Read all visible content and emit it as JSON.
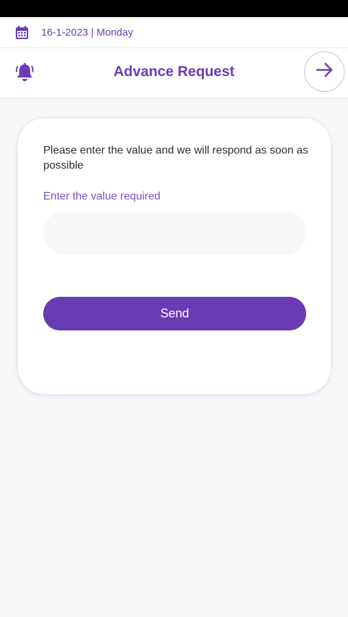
{
  "date_bar": {
    "icon": "calendar-icon",
    "date_text": "16-1-2023 | Monday"
  },
  "header": {
    "left_icon": "bell-icon",
    "title": "Advance Request",
    "right_icon": "arrow-right-icon"
  },
  "form": {
    "message": "Please enter the value and we will respond as soon as possible",
    "field_label": "Enter the value required",
    "input_value": "",
    "input_placeholder": "",
    "send_label": "Send"
  },
  "colors": {
    "accent": "#6a3bb5",
    "background": "#f8f8f8",
    "card": "#ffffff"
  }
}
